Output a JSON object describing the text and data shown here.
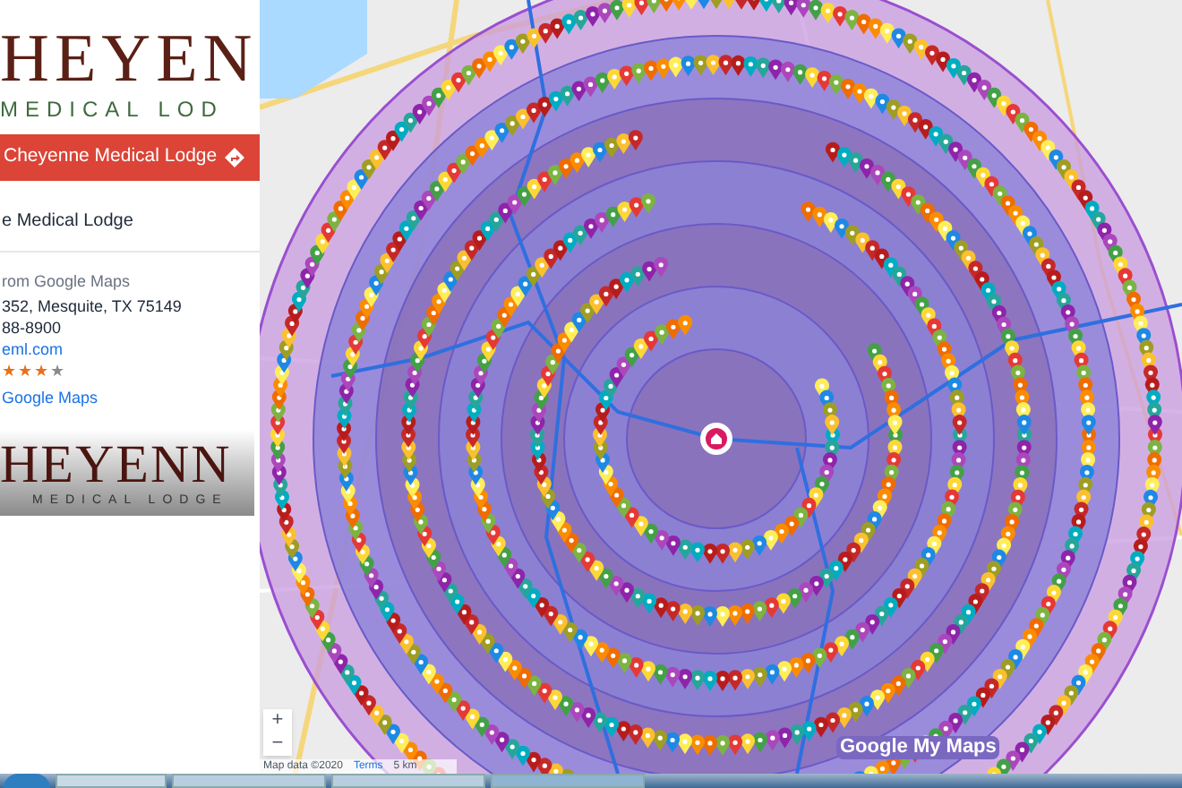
{
  "place_panel": {
    "logo": {
      "wordmark": "HEYEN",
      "subtitle": "MEDICAL LOD"
    },
    "header": {
      "title": "Cheyenne Medical Lodge"
    },
    "name": "e Medical Lodge",
    "source": "rom Google Maps",
    "address": "352, Mesquite, TX 75149",
    "phone": "88-8900",
    "website": "eml.com",
    "stars": 3,
    "link": "Google Maps",
    "photo_logo": {
      "wordmark": "HEYENN",
      "subtitle": "MEDICAL LODGE"
    }
  },
  "map": {
    "zoom_in": "+",
    "zoom_out": "−",
    "attribution": "Map data ©2020",
    "terms": "Terms",
    "scale": "5 km",
    "logo": "Google My Maps"
  }
}
